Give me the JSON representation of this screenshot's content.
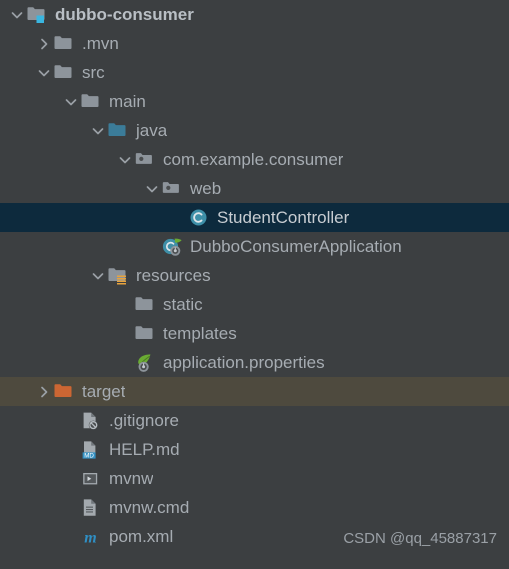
{
  "theme": {
    "background": "#3c3f41",
    "text": "#a6acb2",
    "selected_row_background": "#0d2a3d",
    "hover_row_background": "#4e4a3e",
    "source_root_color": "#3b7c99",
    "module_badge_color": "#3ab6e0",
    "target_folder_color": "#cc6633",
    "resources_badge_color": "#e8a33d",
    "class_icon_color": "#3e8fa8",
    "spring_icon_color": "#6aab33",
    "md_badge_color": "#3592c4",
    "maven_icon_color": "#2f8fc4"
  },
  "tree": {
    "name": "project-tool-window",
    "rows": [
      {
        "label": "dubbo-consumer",
        "depth": 0,
        "arrow": "expanded",
        "icon": "module-folder-icon",
        "bold": true,
        "state": "normal"
      },
      {
        "label": ".mvn",
        "depth": 1,
        "arrow": "collapsed",
        "icon": "folder-icon",
        "bold": false,
        "state": "normal"
      },
      {
        "label": "src",
        "depth": 1,
        "arrow": "expanded",
        "icon": "folder-icon",
        "bold": false,
        "state": "normal"
      },
      {
        "label": "main",
        "depth": 2,
        "arrow": "expanded",
        "icon": "folder-icon",
        "bold": false,
        "state": "normal"
      },
      {
        "label": "java",
        "depth": 3,
        "arrow": "expanded",
        "icon": "source-root-folder-icon",
        "bold": false,
        "state": "normal"
      },
      {
        "label": "com.example.consumer",
        "depth": 4,
        "arrow": "expanded",
        "icon": "package-icon",
        "bold": false,
        "state": "normal"
      },
      {
        "label": "web",
        "depth": 5,
        "arrow": "expanded",
        "icon": "package-icon",
        "bold": false,
        "state": "normal"
      },
      {
        "label": "StudentController",
        "depth": 6,
        "arrow": "none",
        "icon": "java-class-icon",
        "bold": false,
        "state": "selected"
      },
      {
        "label": "DubboConsumerApplication",
        "depth": 5,
        "arrow": "none",
        "icon": "spring-boot-class-icon",
        "bold": false,
        "state": "normal"
      },
      {
        "label": "resources",
        "depth": 3,
        "arrow": "expanded",
        "icon": "resources-root-folder-icon",
        "bold": false,
        "state": "normal"
      },
      {
        "label": "static",
        "depth": 4,
        "arrow": "none",
        "icon": "folder-icon",
        "bold": false,
        "state": "normal"
      },
      {
        "label": "templates",
        "depth": 4,
        "arrow": "none",
        "icon": "folder-icon",
        "bold": false,
        "state": "normal"
      },
      {
        "label": "application.properties",
        "depth": 4,
        "arrow": "none",
        "icon": "spring-properties-icon",
        "bold": false,
        "state": "normal"
      },
      {
        "label": "target",
        "depth": 1,
        "arrow": "collapsed",
        "icon": "excluded-folder-icon",
        "bold": false,
        "state": "hover"
      },
      {
        "label": ".gitignore",
        "depth": 2,
        "arrow": "none",
        "icon": "gitignore-file-icon",
        "bold": false,
        "state": "normal"
      },
      {
        "label": "HELP.md",
        "depth": 2,
        "arrow": "none",
        "icon": "markdown-file-icon",
        "bold": false,
        "state": "normal"
      },
      {
        "label": "mvnw",
        "depth": 2,
        "arrow": "none",
        "icon": "shell-script-icon",
        "bold": false,
        "state": "normal"
      },
      {
        "label": "mvnw.cmd",
        "depth": 2,
        "arrow": "none",
        "icon": "text-file-icon",
        "bold": false,
        "state": "normal"
      },
      {
        "label": "pom.xml",
        "depth": 2,
        "arrow": "none",
        "icon": "maven-pom-icon",
        "bold": false,
        "state": "normal"
      }
    ]
  },
  "watermark": {
    "text": "CSDN @qq_45887317"
  }
}
